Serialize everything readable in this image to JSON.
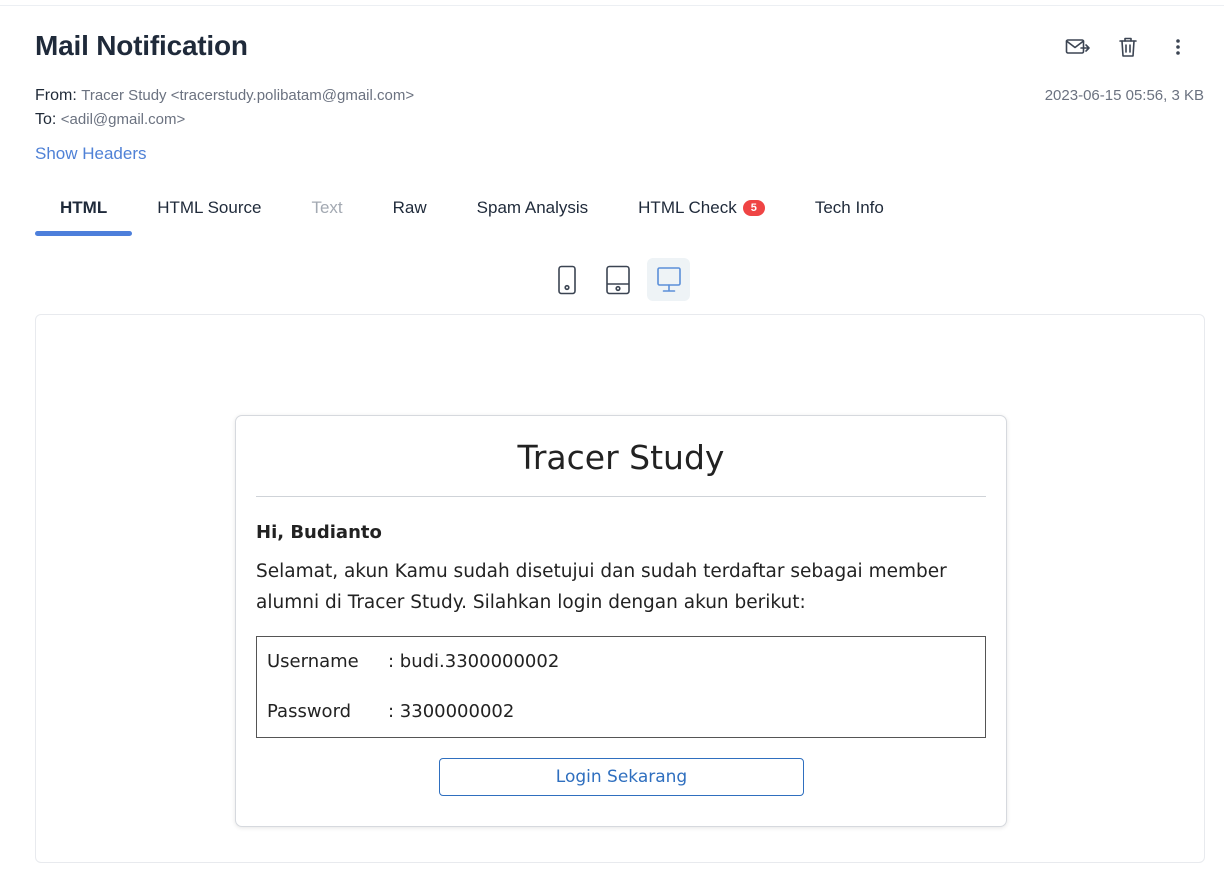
{
  "header": {
    "title": "Mail Notification"
  },
  "actions": [
    {
      "icon": "envelope-forward-icon"
    },
    {
      "icon": "trash-icon"
    },
    {
      "icon": "more-vertical-icon"
    }
  ],
  "meta": {
    "from_label": "From:",
    "from_value": "Tracer Study <tracerstudy.polibatam@gmail.com>",
    "to_label": "To:",
    "to_value": "<adil@gmail.com>",
    "date_size": "2023-06-15 05:56, 3 KB"
  },
  "show_headers": "Show Headers",
  "tabs": [
    {
      "label": "HTML",
      "state": "active"
    },
    {
      "label": "HTML Source",
      "state": "normal"
    },
    {
      "label": "Text",
      "state": "disabled"
    },
    {
      "label": "Raw",
      "state": "normal"
    },
    {
      "label": "Spam Analysis",
      "state": "normal"
    },
    {
      "label": "HTML Check",
      "badge": "5",
      "state": "normal"
    },
    {
      "label": "Tech Info",
      "state": "normal"
    }
  ],
  "devices": [
    {
      "icon": "phone-icon",
      "active": false
    },
    {
      "icon": "tablet-icon",
      "active": false
    },
    {
      "icon": "desktop-icon",
      "active": true
    }
  ],
  "email": {
    "title": "Tracer Study",
    "greeting": "Hi, Budianto",
    "body": "Selamat, akun Kamu sudah disetujui dan sudah terdaftar sebagai member alumni di Tracer Study. Silahkan login dengan akun berikut:",
    "credentials": [
      {
        "key": "Username",
        "value": ": budi.3300000002"
      },
      {
        "key": "Password",
        "value": ": 3300000002"
      }
    ],
    "button": "Login Sekarang"
  },
  "colors": {
    "accent": "#4d7fdb",
    "link": "#4f81d6",
    "badge": "#ef4444",
    "email_button": "#2f6fbf"
  }
}
